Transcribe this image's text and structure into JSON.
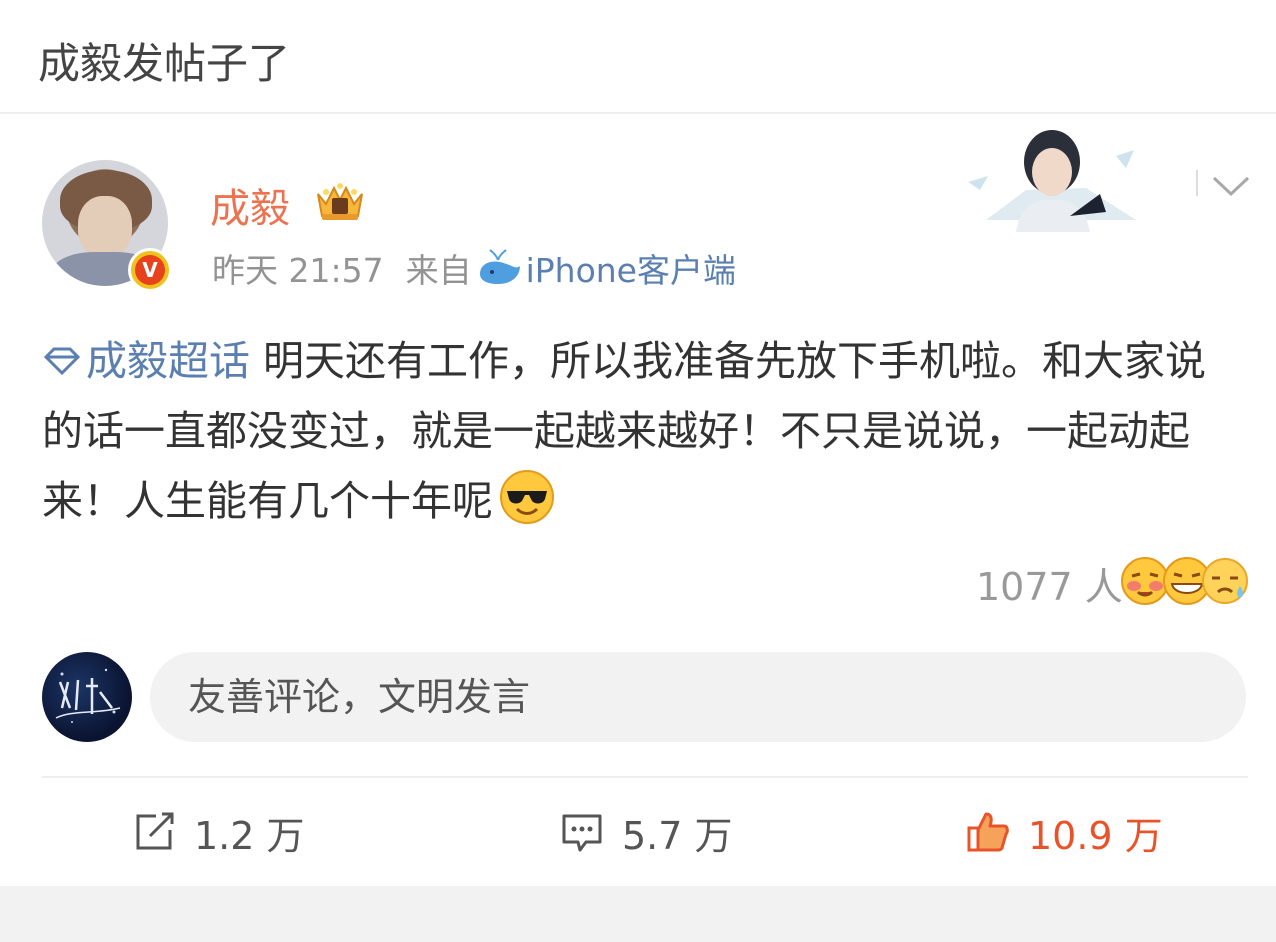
{
  "header": {
    "title": "成毅发帖子了"
  },
  "post": {
    "username": "成毅",
    "time": "昨天 21:57",
    "source_prefix": "来自",
    "source": "iPhone客户端",
    "topic": "成毅超话",
    "text": " 明天还有工作，所以我准备先放下手机啦。和大家说的话一直都没变过，就是一起越来越好！不只是说说，一起动起来！人生能有几个十年呢",
    "verified_badge": "V",
    "colors": {
      "username": "#eb7350",
      "link": "#5a7fb0",
      "like": "#e8542a"
    }
  },
  "reactions": {
    "count": "1077 人",
    "icons": [
      "blush-face-icon",
      "grin-face-icon",
      "sweat-face-icon"
    ]
  },
  "comment_box": {
    "placeholder": "友善评论，文明发言"
  },
  "actions": {
    "repost": "1.2 万",
    "comment": "5.7 万",
    "like": "10.9 万"
  }
}
